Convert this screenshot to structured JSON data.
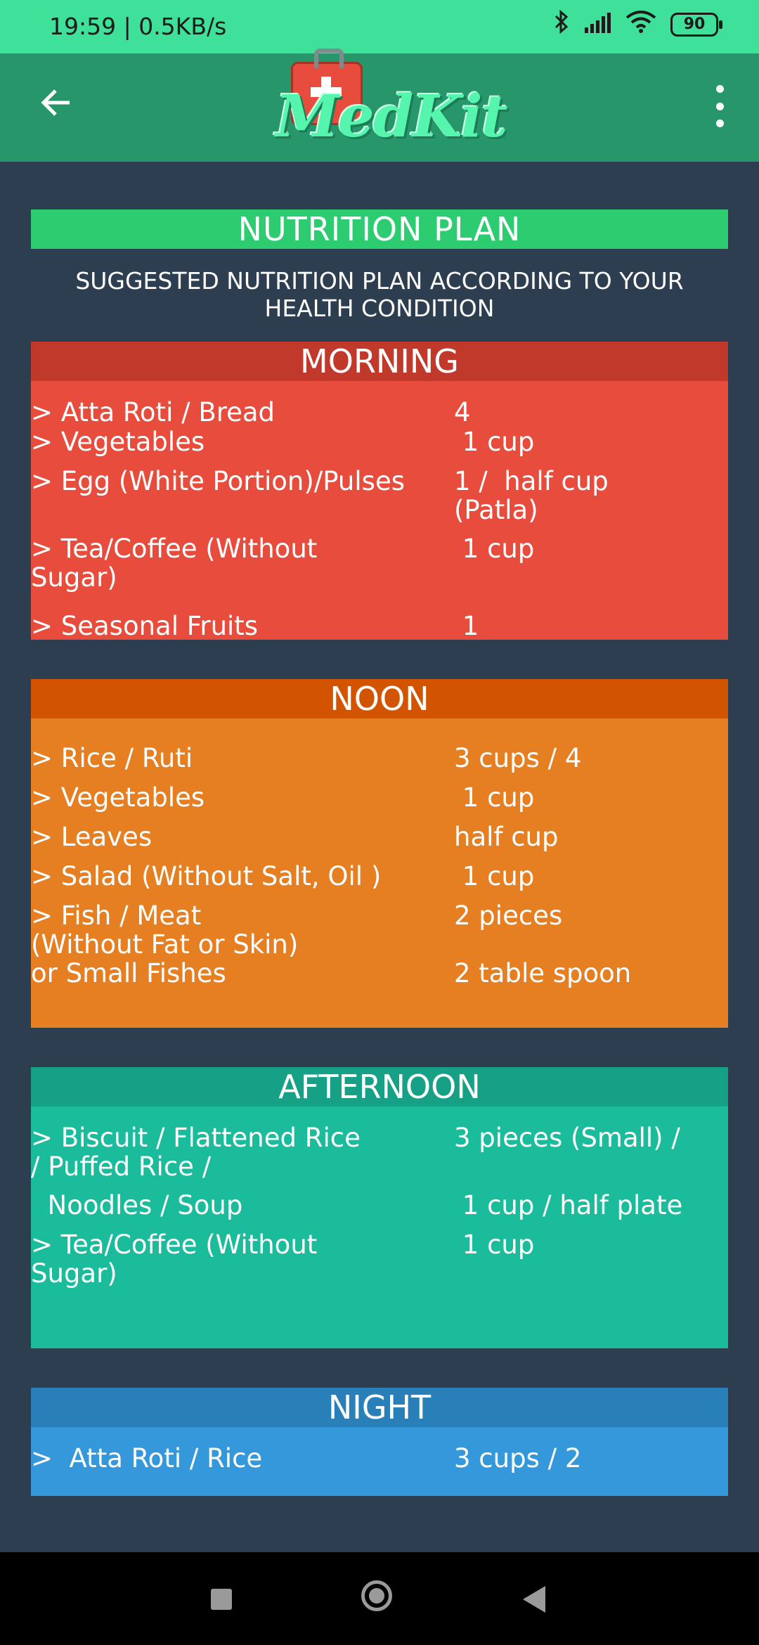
{
  "status_bar": {
    "time": "19:59 | 0.5KB/s",
    "icons": [
      "bluetooth-icon",
      "signal-icon",
      "wifi-icon"
    ],
    "battery": "90"
  },
  "app_bar": {
    "logo_text": "MedKit"
  },
  "title": "NUTRITION PLAN",
  "subtitle": "SUGGESTED NUTRITION PLAN ACCORDING TO YOUR HEALTH CONDITION",
  "sections": {
    "morning": {
      "heading": "MORNING",
      "rows": [
        {
          "item": "> Atta Roti / Bread",
          "qty": "4"
        },
        {
          "item": "> Vegetables",
          "qty": " 1 cup"
        },
        {
          "item": "> Egg (White Portion)/Pulses",
          "qty": "1 /  half cup\n(Patla)"
        },
        {
          "item": "> Tea/Coffee (Without\nSugar)",
          "qty": " 1 cup"
        },
        {
          "item": "> Seasonal Fruits",
          "qty": " 1"
        }
      ]
    },
    "noon": {
      "heading": "NOON",
      "rows": [
        {
          "item": "> Rice / Ruti",
          "qty": "3 cups / 4"
        },
        {
          "item": "> Vegetables",
          "qty": " 1 cup"
        },
        {
          "item": "> Leaves",
          "qty": "half cup"
        },
        {
          "item": "> Salad (Without Salt, Oil )",
          "qty": " 1 cup"
        },
        {
          "item": "> Fish / Meat\n(Without Fat or Skin)\nor Small Fishes",
          "qty": "2 pieces\n\n2 table spoon"
        }
      ]
    },
    "afternoon": {
      "heading": "AFTERNOON",
      "rows": [
        {
          "item": "> Biscuit / Flattened Rice\n/ Puffed Rice /",
          "qty": "3 pieces (Small) /"
        },
        {
          "item": "  Noodles / Soup",
          "qty": " 1 cup / half plate"
        },
        {
          "item": "> Tea/Coffee (Without\nSugar)",
          "qty": " 1 cup"
        }
      ]
    },
    "night": {
      "heading": "NIGHT",
      "rows": [
        {
          "item": ">  Atta Roti / Rice",
          "qty": "3 cups / 2"
        }
      ]
    }
  },
  "colors": {
    "status_bar": "#3ee09a",
    "app_bar": "#27966b",
    "background": "#2c3e50",
    "title_bar": "#2ecc71",
    "morning": "#e74c3c",
    "noon": "#e67e22",
    "afternoon": "#1abc9c",
    "night": "#3498db"
  },
  "nav_bar": {
    "icons": [
      "recents-icon",
      "home-icon",
      "back-icon"
    ]
  }
}
